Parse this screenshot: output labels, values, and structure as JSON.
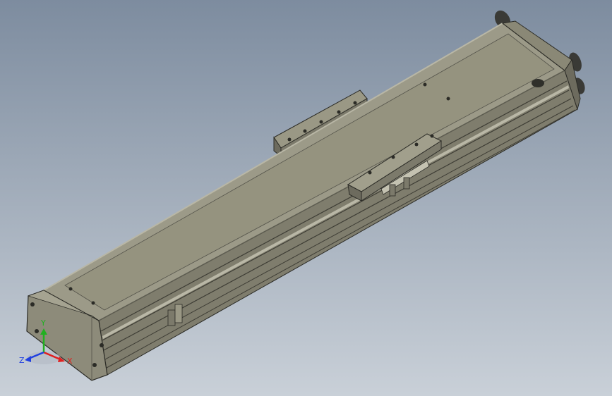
{
  "viewport": {
    "background_top": "#7d8c9f",
    "background_bottom": "#c9d0d8"
  },
  "model": {
    "body_color": "#8d8b7a",
    "body_top_color": "#9c9a88",
    "body_dark_color": "#5f5e52",
    "edge_color": "#2b2b26",
    "highlight_color": "#b9b7a6"
  },
  "triad": {
    "x_label": "X",
    "y_label": "Y",
    "z_label": "Z",
    "x_color": "#e02020",
    "y_color": "#20b020",
    "z_color": "#2040e0"
  }
}
